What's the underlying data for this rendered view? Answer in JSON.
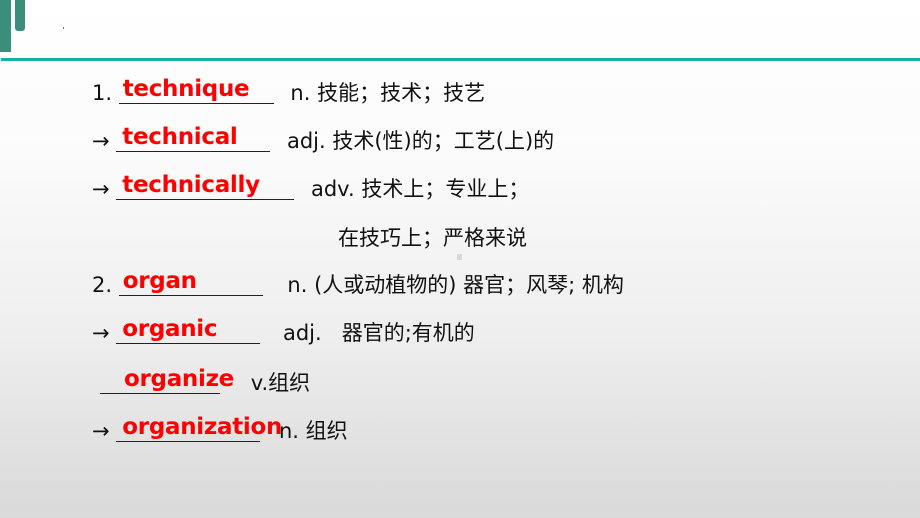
{
  "slide": {
    "colors": {
      "accent": "#14b39a",
      "decor": "#3b8d7c",
      "answer": "#ff0000",
      "text": "#111111"
    },
    "entries": [
      {
        "prefix": "1. ",
        "answer": "technique",
        "definition": "n. 技能；技术；技艺"
      },
      {
        "prefix": "→",
        "answer": "technical",
        "definition": "adj. 技术(性)的；工艺(上)的"
      },
      {
        "prefix": "→",
        "answer": "technically",
        "definition": "adv. 技术上；专业上；"
      },
      {
        "prefix": "",
        "answer": "",
        "definition": "在技巧上；严格来说"
      },
      {
        "prefix": "2. ",
        "answer": "organ",
        "definition": "n. (人或动植物的) 器官；风琴; 机构"
      },
      {
        "prefix": "→",
        "answer": "organic",
        "definition": "adj.   器官的;有机的"
      },
      {
        "prefix": "",
        "answer": "organize",
        "definition": "v.组织"
      },
      {
        "prefix": "→",
        "answer": "organization",
        "definition": "n. 组织"
      }
    ]
  }
}
